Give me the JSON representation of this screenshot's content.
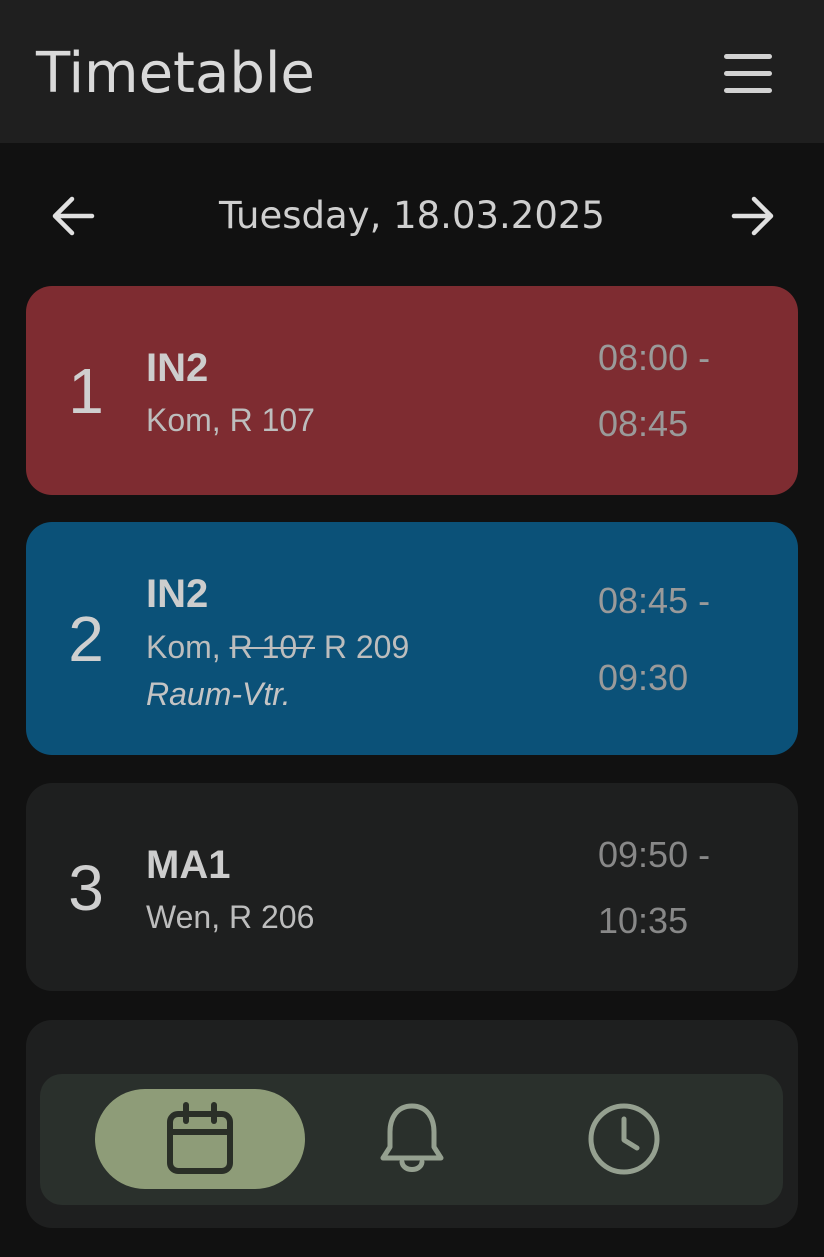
{
  "appbar": {
    "title": "Timetable",
    "menu_icon": "menu-icon"
  },
  "date_nav": {
    "prev_icon": "arrow-left-icon",
    "date": "Tuesday, 18.03.2025",
    "next_icon": "arrow-right-icon"
  },
  "lessons": [
    {
      "number": "1",
      "subject": "IN2",
      "teacher": "Kom,",
      "room": "R 107",
      "time_start": "08:00 -",
      "time_end": "08:45",
      "color": "#7e2c31"
    },
    {
      "number": "2",
      "subject": "IN2",
      "teacher": "Kom,",
      "room_old": "R 107",
      "room": "R 209",
      "note": "Raum-Vtr.",
      "time_start": "08:45 -",
      "time_end": "09:30",
      "color": "#0b5178"
    },
    {
      "number": "3",
      "subject": "MA1",
      "teacher": "Wen,",
      "room": "R 206",
      "time_start": "09:50 -",
      "time_end": "10:35",
      "color": "#1e1f1f"
    }
  ],
  "bottom_nav": {
    "items": [
      {
        "icon": "calendar-icon",
        "active": true
      },
      {
        "icon": "bell-icon",
        "active": false
      },
      {
        "icon": "clock-icon",
        "active": false
      }
    ],
    "active_color": "#8e9c78"
  }
}
